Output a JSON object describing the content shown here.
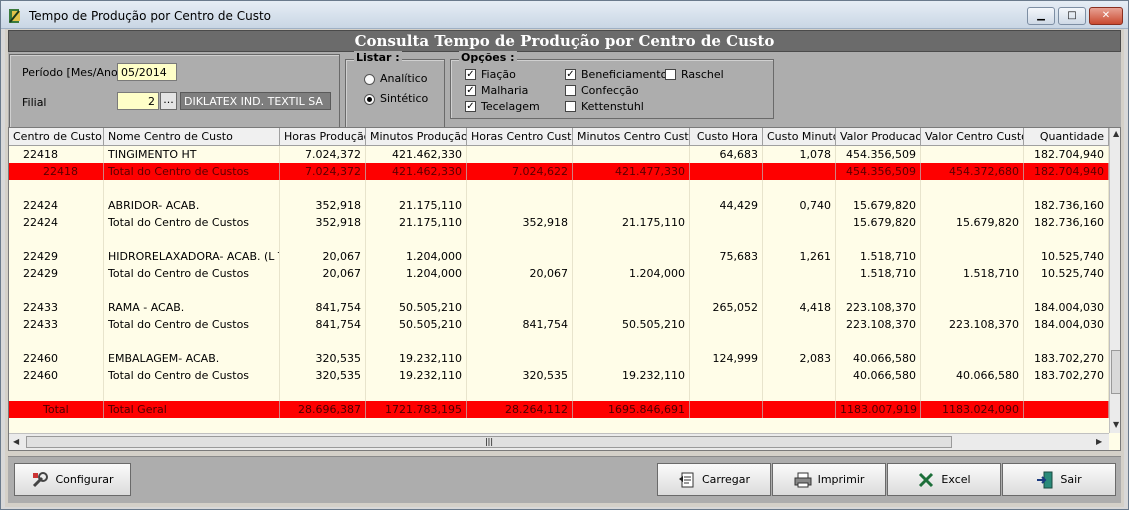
{
  "window": {
    "title": "Tempo de Produção por Centro de Custo"
  },
  "header": {
    "title": "Consulta Tempo de Produção por Centro de Custo"
  },
  "filters": {
    "periodo_label": "Período [Mes/Ano]",
    "periodo_value": "05/2014",
    "filial_label": "Filial",
    "filial_code": "2",
    "filial_btn": "...",
    "filial_name": "DIKLATEX IND. TEXTIL SA",
    "listar_title": "Listar :",
    "listar_options": [
      "Analítico",
      "Sintético"
    ],
    "listar_selected": "Sintético",
    "opcoes_title": "Opções :",
    "opcoes": [
      {
        "label": "Fiação",
        "checked": true
      },
      {
        "label": "Malharia",
        "checked": true
      },
      {
        "label": "Tecelagem",
        "checked": true
      },
      {
        "label": "Beneficiamento",
        "checked": true
      },
      {
        "label": "Confecção",
        "checked": false
      },
      {
        "label": "Kettenstuhl",
        "checked": false
      },
      {
        "label": "Raschel",
        "checked": false
      }
    ]
  },
  "grid": {
    "columns": [
      "Centro de Custo",
      "Nome Centro de Custo",
      "Horas Produção",
      "Minutos Produção",
      "Horas Centro Custo",
      "Minutos Centro Custo",
      "Custo Hora",
      "Custo Minuto",
      "Valor Producao",
      "Valor Centro Custo",
      "Quantidade"
    ],
    "rows": [
      {
        "type": "detail",
        "cells": [
          "22418",
          "TINGIMENTO  HT",
          "7.024,372",
          "421.462,330",
          "",
          "",
          "64,683",
          "1,078",
          "454.356,509",
          "",
          "182.704,940"
        ]
      },
      {
        "type": "total",
        "cells": [
          "22418",
          "Total do Centro de Custos",
          "7.024,372",
          "421.462,330",
          "7.024,622",
          "421.477,330",
          "",
          "",
          "454.356,509",
          "454.372,680",
          "182.704,940"
        ]
      },
      {
        "type": "blank",
        "cells": [
          "",
          "",
          "",
          "",
          "",
          "",
          "",
          "",
          "",
          "",
          ""
        ]
      },
      {
        "type": "detail",
        "cells": [
          "22424",
          "ABRIDOR- ACAB.",
          "352,918",
          "21.175,110",
          "",
          "",
          "44,429",
          "0,740",
          "15.679,820",
          "",
          "182.736,160"
        ]
      },
      {
        "type": "detail",
        "cells": [
          "22424",
          "Total do Centro de Custos",
          "352,918",
          "21.175,110",
          "352,918",
          "21.175,110",
          "",
          "",
          "15.679,820",
          "15.679,820",
          "182.736,160"
        ]
      },
      {
        "type": "blank",
        "cells": [
          "",
          "",
          "",
          "",
          "",
          "",
          "",
          "",
          "",
          "",
          ""
        ]
      },
      {
        "type": "detail",
        "cells": [
          "22429",
          "HIDRORELAXADORA- ACAB. (L T)",
          "20,067",
          "1.204,000",
          "",
          "",
          "75,683",
          "1,261",
          "1.518,710",
          "",
          "10.525,740"
        ]
      },
      {
        "type": "detail",
        "cells": [
          "22429",
          "Total do Centro de Custos",
          "20,067",
          "1.204,000",
          "20,067",
          "1.204,000",
          "",
          "",
          "1.518,710",
          "1.518,710",
          "10.525,740"
        ]
      },
      {
        "type": "blank",
        "cells": [
          "",
          "",
          "",
          "",
          "",
          "",
          "",
          "",
          "",
          "",
          ""
        ]
      },
      {
        "type": "detail",
        "cells": [
          "22433",
          "RAMA - ACAB.",
          "841,754",
          "50.505,210",
          "",
          "",
          "265,052",
          "4,418",
          "223.108,370",
          "",
          "184.004,030"
        ]
      },
      {
        "type": "detail",
        "cells": [
          "22433",
          "Total do Centro de Custos",
          "841,754",
          "50.505,210",
          "841,754",
          "50.505,210",
          "",
          "",
          "223.108,370",
          "223.108,370",
          "184.004,030"
        ]
      },
      {
        "type": "blank",
        "cells": [
          "",
          "",
          "",
          "",
          "",
          "",
          "",
          "",
          "",
          "",
          ""
        ]
      },
      {
        "type": "detail",
        "cells": [
          "22460",
          "EMBALAGEM- ACAB.",
          "320,535",
          "19.232,110",
          "",
          "",
          "124,999",
          "2,083",
          "40.066,580",
          "",
          "183.702,270"
        ]
      },
      {
        "type": "detail",
        "cells": [
          "22460",
          "Total do Centro de Custos",
          "320,535",
          "19.232,110",
          "320,535",
          "19.232,110",
          "",
          "",
          "40.066,580",
          "40.066,580",
          "183.702,270"
        ]
      },
      {
        "type": "blank",
        "cells": [
          "",
          "",
          "",
          "",
          "",
          "",
          "",
          "",
          "",
          "",
          ""
        ]
      },
      {
        "type": "grand",
        "cells": [
          "Total",
          "Total Geral",
          "28.696,387",
          "1721.783,195",
          "28.264,112",
          "1695.846,691",
          "",
          "",
          "1183.007,919",
          "1183.024,090",
          ""
        ]
      }
    ]
  },
  "buttons": {
    "configurar": "Configurar",
    "carregar": "Carregar",
    "imprimir": "Imprimir",
    "excel": "Excel",
    "sair": "Sair"
  },
  "colors": {
    "total_row": "#fe0000",
    "grid_bg": "#fffde8",
    "header_band": "#6b6b6b"
  }
}
